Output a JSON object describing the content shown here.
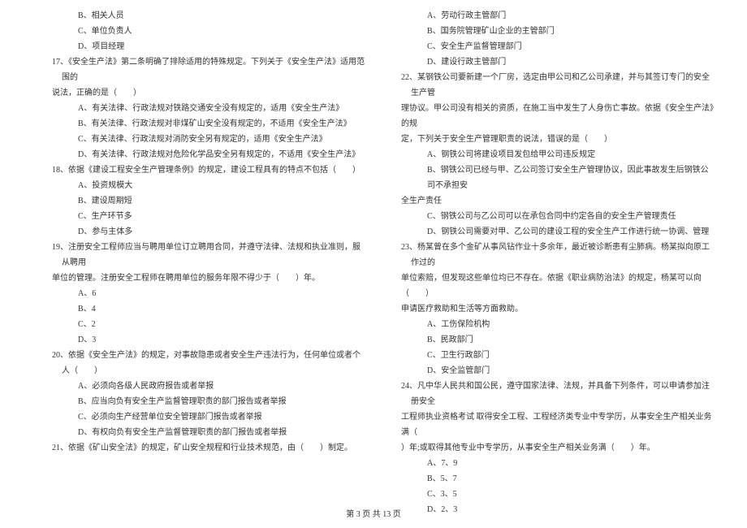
{
  "left": {
    "optB_16": "B、相关人员",
    "optC_16": "C、单位负责人",
    "optD_16": "D、项目经理",
    "q17_l1": "17、《安全生产法》第二条明确了排除适用的特殊规定。下列关于《安全生产法》适用范围的",
    "q17_l2": "说法，正确的是（　　）",
    "q17_A": "A、有关法律、行政法规对铁路交通安全没有规定的，适用《安全生产法》",
    "q17_B": "B、有关法律、行政法规对非煤矿山安全没有规定的，不适用《安全生产法》",
    "q17_C": "C、有关法律、行政法规对消防安全另有规定的，适用《安全生产法》",
    "q17_D": "D、有关法律、行政法规对危险化学品安全另有规定的，不适用《安全生产法》",
    "q18_l1": "18、依据《建设工程安全生产管理条例》的规定，建设工程具有的特点不包括（　　）",
    "q18_A": "A、投资规模大",
    "q18_B": "B、建设周期短",
    "q18_C": "C、生产环节多",
    "q18_D": "D、参与主体多",
    "q19_l1": "19、注册安全工程师应当与聘用单位订立聘用合同，并遵守法律、法规和执业准则，服从聘用",
    "q19_l2": "单位的管理。注册安全工程师在聘用单位的服务年限不得少于（　　）年。",
    "q19_A": "A、6",
    "q19_B": "B、4",
    "q19_C": "C、2",
    "q19_D": "D、3",
    "q20_l1": "20、依据《安全生产法》的规定，对事故隐患或者安全生产违法行为，任何单位或者个人（　　）",
    "q20_A": "A、必须向各级人民政府报告或者举报",
    "q20_B": "B、应当向负有安全生产监督管理职责的部门报告或者举报",
    "q20_C": "C、必须向生产经营单位安全管理部门报告或者举报",
    "q20_D": "D、有权向负有安全生产监督管理职责的部门报告或者举报",
    "q21_l1": "21、依据《矿山安全法》的规定，矿山安全规程和行业技术规范，由（　　）制定。"
  },
  "right": {
    "q21_A": "A、劳动行政主管部门",
    "q21_B": "B、国务院管理矿山企业的主管部门",
    "q21_C": "C、安全生产监督管理部门",
    "q21_D": "D、建设行政主管部门",
    "q22_l1": "22、某钢铁公司要新建一个厂房，选定由甲公司和乙公司承建，并与其签订专门的安全生产管",
    "q22_l2": "理协议。甲公司没有相关的资质，在施工当中发生了人身伤亡事故。依据《安全生产法》的规",
    "q22_l3": "定，下列关于安全生产管理职责的说法，错误的是（　　）",
    "q22_A": "A、钢铁公司将建设项目发包给甲公司违反规定",
    "q22_B1": "B、钢铁公司已经与甲、乙公司签订安全生产管理协议，因此事故发生后钢铁公司不承担安",
    "q22_B2": "全生产责任",
    "q22_C": "C、钢铁公司与乙公司可以在承包合同中约定各自的安全生产管理责任",
    "q22_D": "D、钢铁公司需要对甲、乙公司的建设工程的安全生产工作进行统一协调、管理",
    "q23_l1": "23、杨某曾在多个金矿从事风钻作业十多余年，最近被诊断患有尘肺病。杨某拟向原工作过的",
    "q23_l2": "单位索赔，但发现这些单位均已不存在。依据《职业病防治法》的规定，杨某可以向（　　）",
    "q23_l3": "申请医疗救助和生活等方面救助。",
    "q23_A": "A、工伤保险机构",
    "q23_B": "B、民政部门",
    "q23_C": "C、卫生行政部门",
    "q23_D": "D、安全监管部门",
    "q24_l1": "24、凡中华人民共和国公民，遵守国家法律、法规，并具备下列条件，可以申请参加注册安全",
    "q24_l2": "工程师执业资格考试 取得安全工程、工程经济类专业中专学历，从事安全生产相关业务满（　",
    "q24_l3": "）年;或取得其他专业中专学历，从事安全生产相关业务满（　　）年。",
    "q24_A": "A、7、9",
    "q24_B": "B、5、7",
    "q24_C": "C、3、5",
    "q24_D": "D、2、3"
  },
  "footer": "第 3 页 共 13 页"
}
